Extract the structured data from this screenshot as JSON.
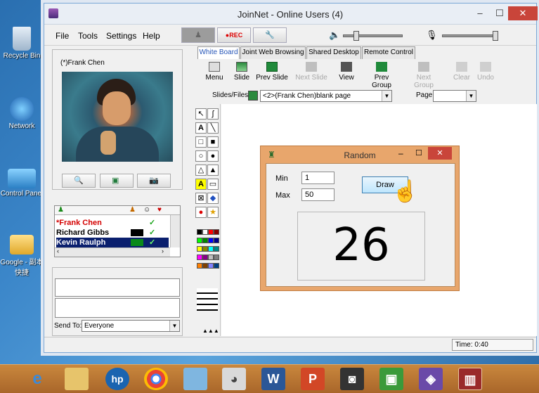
{
  "desktop": {
    "icons": [
      {
        "label": "Recycle Bin"
      },
      {
        "label": "Network"
      },
      {
        "label": "Control Panel"
      },
      {
        "label": "Google - 副本\n快捷"
      }
    ]
  },
  "window": {
    "title": "JoinNet - Online Users (4)",
    "menu": [
      "File",
      "Tools",
      "Settings",
      "Help"
    ],
    "rec_label": "●REC",
    "video_caption": "(*)Frank Chen",
    "users": [
      {
        "name": "*Frank Chen",
        "color": "#d40000"
      },
      {
        "name": "Richard Gibbs",
        "color": "#000000"
      },
      {
        "name": "Kevin Raulph",
        "color": "#ffffff"
      }
    ],
    "send_to_label": "Send To:",
    "send_to_value": "Everyone",
    "tabs": [
      "White Board",
      "Joint Web Browsing",
      "Shared Desktop",
      "Remote Control"
    ],
    "wb_tools": [
      {
        "label": "Menu"
      },
      {
        "label": "Slide"
      },
      {
        "label": "Prev Slide"
      },
      {
        "label": "Next Slide"
      },
      {
        "label": "View"
      },
      {
        "label": "Prev Group"
      },
      {
        "label": "Next Group"
      },
      {
        "label": "Clear"
      },
      {
        "label": "Undo"
      }
    ],
    "slides_label": "Slides/Files",
    "slides_value": "<2>(Frank Chen)blank page",
    "page_label": "Page",
    "page_value": "",
    "status_time": "Time: 0:40",
    "palette": [
      "#000000",
      "#ffffff",
      "#ff0000",
      "#880000",
      "#00ff00",
      "#008800",
      "#0000ff",
      "#000088",
      "#ffff00",
      "#888800",
      "#00ffff",
      "#008888",
      "#ff00ff",
      "#880088",
      "#c0c0c0",
      "#808080",
      "#ff8000",
      "#804000",
      "#8080ff",
      "#004080"
    ]
  },
  "dialog": {
    "title": "Random",
    "min_label": "Min",
    "min_value": "1",
    "max_label": "Max",
    "max_value": "50",
    "draw_label": "Draw",
    "result": "26"
  },
  "taskbar": {
    "apps": [
      "internet-explorer",
      "file-explorer",
      "hp",
      "chrome",
      "notepad",
      "paint",
      "word",
      "powerpoint",
      "camera",
      "photos",
      "screen-capture",
      "joinnet"
    ]
  }
}
